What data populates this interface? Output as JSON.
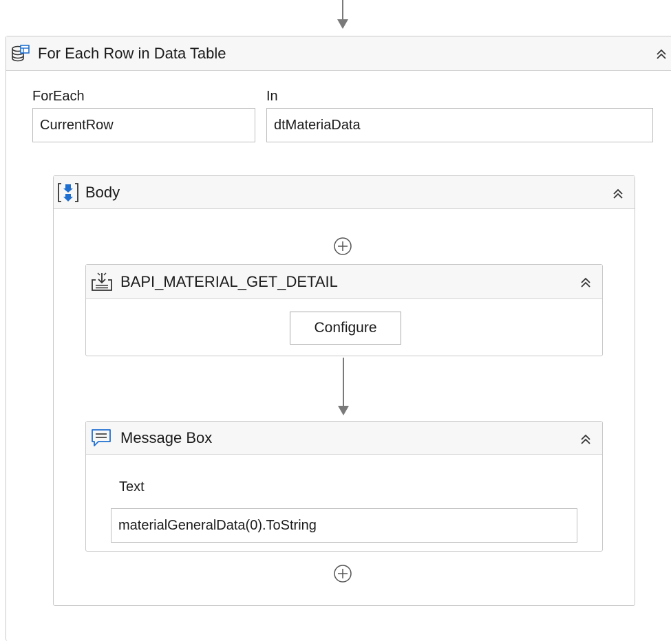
{
  "for_each": {
    "title": "For Each Row in Data Table",
    "icon": "data-table-icon",
    "foreach_label": "ForEach",
    "foreach_value": "CurrentRow",
    "in_label": "In",
    "in_value": "dtMateriaData"
  },
  "body": {
    "title": "Body",
    "icon": "body-sequence-icon"
  },
  "bapi": {
    "title": "BAPI_MATERIAL_GET_DETAIL",
    "icon": "sap-function-icon",
    "configure_label": "Configure"
  },
  "message_box": {
    "title": "Message Box",
    "icon": "message-box-icon",
    "text_label": "Text",
    "text_value": "materialGeneralData(0).ToString"
  },
  "colors": {
    "accent_blue": "#1f6fd1",
    "connector_gray": "#7a7a7a",
    "border_gray": "#c8c8c8"
  }
}
